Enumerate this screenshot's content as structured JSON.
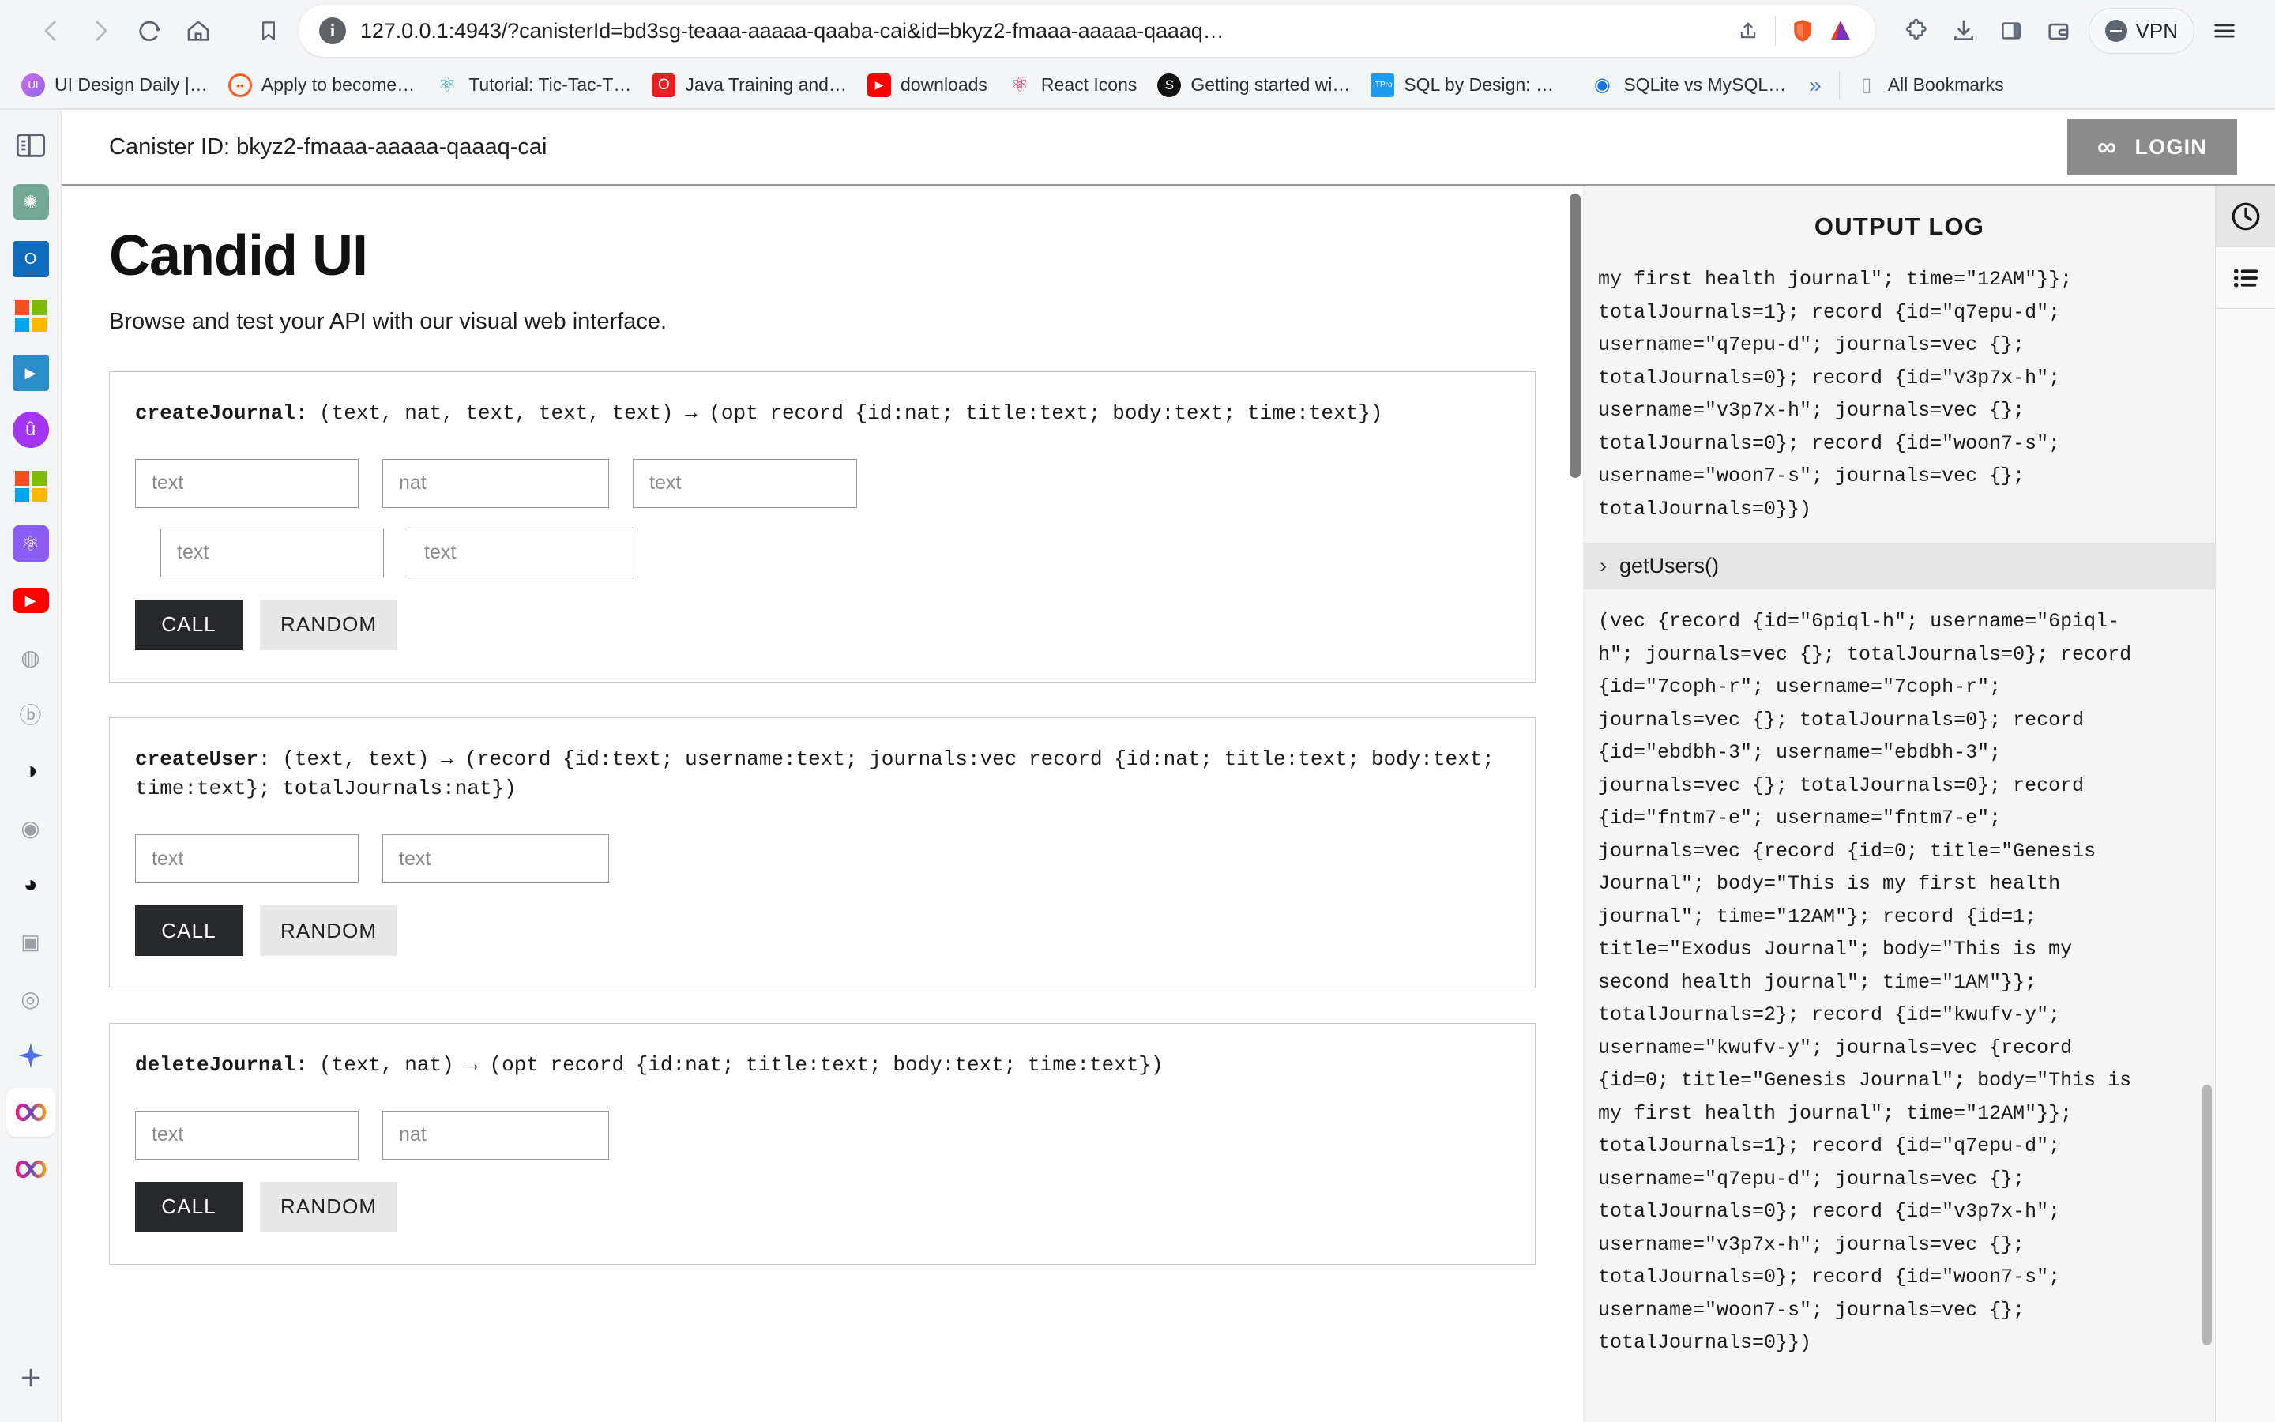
{
  "browser": {
    "nav": {
      "back_icon": "chevron-left-icon",
      "forward_icon": "chevron-right-icon",
      "reload_icon": "reload-icon",
      "home_icon": "home-icon"
    },
    "omnibox": {
      "url": "127.0.0.1:4943/?canisterId=bd3sg-teaaa-aaaaa-qaaba-cai&id=bkyz2-fmaaa-aaaaa-qaaaq…",
      "info_badge": "i",
      "share_icon": "share-icon",
      "shield_icon": "brave-shields-icon",
      "leo_icon": "leo-ai-icon"
    },
    "toolbar_right": {
      "extensions_icon": "puzzle-extensions-icon",
      "downloads_icon": "download-icon",
      "sidebar_icon": "sidebar-panel-icon",
      "wallet_icon": "wallet-icon",
      "vpn_label": "VPN",
      "menu_icon": "hamburger-menu-icon"
    },
    "bookmarks": [
      {
        "label": "UI Design Daily |…",
        "favicon": "ui-design-daily-icon",
        "color": "#c46ae0",
        "glyph": "UI"
      },
      {
        "label": "Apply to become…",
        "favicon": "apply-icon",
        "color": "#ff5a1f",
        "glyph": "◠"
      },
      {
        "label": "Tutorial: Tic-Tac-T…",
        "favicon": "react-icon",
        "color": "#61dafb",
        "glyph": "⚛"
      },
      {
        "label": "Java Training and…",
        "favicon": "java-icon",
        "color": "#e62020",
        "glyph": "O"
      },
      {
        "label": "downloads",
        "favicon": "youtube-icon",
        "color": "#ff0000",
        "glyph": "▶"
      },
      {
        "label": "React Icons",
        "favicon": "react-icons-icon",
        "color": "#e91e63",
        "glyph": "⚛"
      },
      {
        "label": "Getting started wi…",
        "favicon": "globe-dark-icon",
        "color": "#111111",
        "glyph": "S"
      },
      {
        "label": "SQL by Design: W…",
        "favicon": "itpro-icon",
        "color": "#1d9bf0",
        "glyph": "ITPro"
      },
      {
        "label": "SQLite vs MySQL…",
        "favicon": "sqlite-icon",
        "color": "#1a73e8",
        "glyph": "◉"
      }
    ],
    "bookmarks_overflow": "»",
    "all_bookmarks_label": "All Bookmarks",
    "all_bookmarks_icon": "folder-icon"
  },
  "vsidebar": {
    "items": [
      {
        "name": "sidebar-toggle-icon",
        "kind": "panel",
        "color": "#5a6472"
      },
      {
        "name": "chatgpt-icon",
        "kind": "solid",
        "color": "#75a894",
        "glyph": "✺"
      },
      {
        "name": "outlook-icon",
        "kind": "solid",
        "color": "#0f6cbd",
        "glyph": "O"
      },
      {
        "name": "microsoft-icon",
        "kind": "msgrid",
        "color": "#f25022"
      },
      {
        "name": "video-editor-icon",
        "kind": "solid",
        "color": "#2b8ec9",
        "glyph": "▶"
      },
      {
        "name": "udemy-icon",
        "kind": "solid",
        "color": "#a435f0",
        "glyph": "û"
      },
      {
        "name": "microsoft-office-icon",
        "kind": "msgrid",
        "color": "#f25022"
      },
      {
        "name": "atom-icon",
        "kind": "solid",
        "color": "#8b5cf6",
        "glyph": "⚛"
      },
      {
        "name": "youtube-icon",
        "kind": "solid",
        "color": "#ff0000",
        "glyph": "▶"
      },
      {
        "name": "globe-icon",
        "kind": "ghost",
        "color": "#9aa0a6",
        "glyph": "🌐"
      },
      {
        "name": "bing-icon",
        "kind": "ghost",
        "color": "#9aa0a6",
        "glyph": "b"
      },
      {
        "name": "brave-leo-icon",
        "kind": "solid-white",
        "color": "#111111",
        "glyph": "◐"
      },
      {
        "name": "copilot-icon",
        "kind": "ghost",
        "color": "#9aa0a6",
        "glyph": "◕"
      },
      {
        "name": "bard-icon",
        "kind": "solid-white",
        "color": "#111111",
        "glyph": "◑"
      },
      {
        "name": "azure-icon",
        "kind": "ghost",
        "color": "#9aa0a6",
        "glyph": "▣"
      },
      {
        "name": "github-icon",
        "kind": "ghost",
        "color": "#9aa0a6",
        "glyph": "◎"
      },
      {
        "name": "gemini-sparkle-icon",
        "kind": "sparkle",
        "color": "#4f6ef7"
      },
      {
        "name": "internet-computer-icon",
        "kind": "infinity",
        "color": "#ec1e79",
        "selected": true
      },
      {
        "name": "internet-computer-icon",
        "kind": "infinity",
        "color": "#ec1e79"
      }
    ],
    "add_label": "+",
    "add_icon": "plus-icon"
  },
  "candid": {
    "header": {
      "canister_id_label": "Canister ID: bkyz2-fmaaa-aaaaa-qaaaq-cai",
      "login_label": "LOGIN",
      "login_icon": "infinity-icon"
    },
    "title": "Candid UI",
    "subtitle": "Browse and test your API with our visual web interface.",
    "methods": [
      {
        "name": "createJournal",
        "signature": ": (text, nat, text, text, text) → (opt record {id:nat; title:text; body:text; time:text})",
        "arg_rows": [
          [
            {
              "placeholder": "text",
              "width": "w-sm"
            },
            {
              "placeholder": "nat",
              "width": "w-md"
            },
            {
              "placeholder": "text",
              "width": "w-lg"
            }
          ],
          [
            {
              "placeholder": "text",
              "width": "w-sm"
            },
            {
              "placeholder": "text",
              "width": "w-md"
            }
          ]
        ],
        "indent_second_row": true,
        "call_label": "CALL",
        "random_label": "RANDOM"
      },
      {
        "name": "createUser",
        "signature": ": (text, text) → (record {id:text; username:text; journals:vec record {id:nat; title:text; body:text; time:text}; totalJournals:nat})",
        "arg_rows": [
          [
            {
              "placeholder": "text",
              "width": "w-sm"
            },
            {
              "placeholder": "text",
              "width": "w-md"
            }
          ]
        ],
        "indent_second_row": false,
        "call_label": "CALL",
        "random_label": "RANDOM"
      },
      {
        "name": "deleteJournal",
        "signature": ": (text, nat) → (opt record {id:nat; title:text; body:text; time:text})",
        "arg_rows": [
          [
            {
              "placeholder": "text",
              "width": "w-sm"
            },
            {
              "placeholder": "nat",
              "width": "w-md"
            }
          ]
        ],
        "indent_second_row": false,
        "call_label": "CALL",
        "random_label": "RANDOM"
      }
    ]
  },
  "output_log": {
    "title": "OUTPUT LOG",
    "entry_top": "my first health journal\"; time=\"12AM\"}};\ntotalJournals=1}; record {id=\"q7epu-d\";\nusername=\"q7epu-d\"; journals=vec {};\ntotalJournals=0}; record {id=\"v3p7x-h\";\nusername=\"v3p7x-h\"; journals=vec {};\ntotalJournals=0}; record {id=\"woon7-s\";\nusername=\"woon7-s\"; journals=vec {};\ntotalJournals=0}})",
    "call_header": "getUsers()",
    "call_header_chevron": "›",
    "entry_body": "(vec {record {id=\"6piql-h\"; username=\"6piql-\nh\"; journals=vec {}; totalJournals=0}; record\n{id=\"7coph-r\"; username=\"7coph-r\";\njournals=vec {}; totalJournals=0}; record\n{id=\"ebdbh-3\"; username=\"ebdbh-3\";\njournals=vec {}; totalJournals=0}; record\n{id=\"fntm7-e\"; username=\"fntm7-e\";\njournals=vec {record {id=0; title=\"Genesis\nJournal\"; body=\"This is my first health\njournal\"; time=\"12AM\"}; record {id=1;\ntitle=\"Exodus Journal\"; body=\"This is my\nsecond health journal\"; time=\"1AM\"}};\ntotalJournals=2}; record {id=\"kwufv-y\";\nusername=\"kwufv-y\"; journals=vec {record\n{id=0; title=\"Genesis Journal\"; body=\"This is\nmy first health journal\"; time=\"12AM\"}};\ntotalJournals=1}; record {id=\"q7epu-d\";\nusername=\"q7epu-d\"; journals=vec {};\ntotalJournals=0}; record {id=\"v3p7x-h\";\nusername=\"v3p7x-h\"; journals=vec {};\ntotalJournals=0}; record {id=\"woon7-s\";\nusername=\"woon7-s\"; journals=vec {};\ntotalJournals=0}})"
  },
  "rail": {
    "items": [
      {
        "name": "history-clock-icon",
        "active": true
      },
      {
        "name": "list-bullets-icon",
        "active": false
      }
    ]
  }
}
